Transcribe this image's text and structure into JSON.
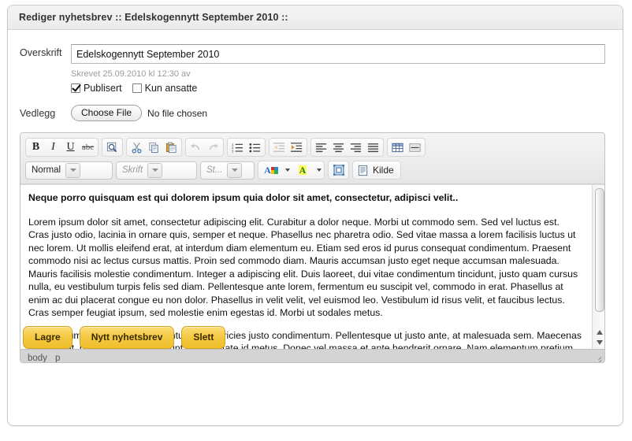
{
  "panel": {
    "title": "Rediger nyhetsbrev :: Edelskogennytt September 2010 ::"
  },
  "form": {
    "title_label": "Overskrift",
    "title_value": "Edelskogennytt September 2010",
    "title_placeholder": "",
    "meta": "Skrevet 25.09.2010 kl 12:30 av",
    "published_label": "Publisert",
    "published_checked": true,
    "staff_only_label": "Kun ansatte",
    "staff_only_checked": false,
    "attachment_label": "Vedlegg",
    "choose_file_label": "Choose File",
    "no_file_label": "No file chosen"
  },
  "editor": {
    "toolbar": {
      "row1": [
        {
          "name": "bold-icon",
          "glyph": "B"
        },
        {
          "name": "italic-icon",
          "glyph": "I"
        },
        {
          "name": "underline-icon",
          "glyph": "U"
        },
        {
          "name": "strikethrough-icon",
          "glyph": "abc"
        },
        {
          "name": "preview-icon",
          "glyph": "⌕"
        },
        {
          "name": "cut-icon",
          "glyph": "✂"
        },
        {
          "name": "copy-icon",
          "glyph": "⧉"
        },
        {
          "name": "paste-icon",
          "glyph": "ὌB"
        },
        {
          "name": "undo-icon",
          "glyph": "↩"
        },
        {
          "name": "redo-icon",
          "glyph": "↪"
        },
        {
          "name": "numbered-list-icon",
          "glyph": "1."
        },
        {
          "name": "bulleted-list-icon",
          "glyph": "•"
        },
        {
          "name": "outdent-icon",
          "glyph": "⇤"
        },
        {
          "name": "indent-icon",
          "glyph": "⇥"
        },
        {
          "name": "align-left-icon",
          "glyph": "≡"
        },
        {
          "name": "align-center-icon",
          "glyph": "≡"
        },
        {
          "name": "align-right-icon",
          "glyph": "≡"
        },
        {
          "name": "justify-icon",
          "glyph": "≡"
        },
        {
          "name": "table-icon",
          "glyph": "▦"
        },
        {
          "name": "horizontal-rule-icon",
          "glyph": "▤"
        }
      ],
      "format_select": "Normal",
      "font_select": "Skrift",
      "size_select": "St...",
      "text_color_label": "A",
      "bg_color_label": "A",
      "maximize_icon": "maximize-icon",
      "source_label": "Kilde"
    },
    "content": {
      "lead": "Neque porro quisquam est qui dolorem ipsum quia dolor sit amet, consectetur, adipisci velit..",
      "paragraph1": "Lorem ipsum dolor sit amet, consectetur adipiscing elit. Curabitur a dolor neque. Morbi ut commodo sem. Sed vel luctus est. Cras justo odio, lacinia in ornare quis, semper et neque. Phasellus nec pharetra odio. Sed vitae massa a lorem facilisis luctus ut nec lorem. Ut mollis eleifend erat, at interdum diam elementum eu. Etiam sed eros id purus consequat condimentum. Praesent commodo nisi ac lectus cursus mattis. Proin sed commodo diam. Mauris accumsan justo eget neque accumsan malesuada. Mauris facilisis molestie condimentum. Integer a adipiscing elit. Duis laoreet, dui vitae condimentum tincidunt, justo quam cursus nulla, eu vestibulum turpis felis sed diam. Pellentesque ante lorem, fermentum eu suscipit vel, commodo in erat. Phasellus at enim ac dui placerat congue eu non dolor. Phasellus in velit velit, vel euismod leo. Vestibulum id risus velit, et faucibus lectus. Cras semper feugiat ipsum, sed molestie enim egestas id. Morbi ut sodales metus.",
      "paragraph2": "Nunc rutrum urna eget dui elementum non ultricies justo condimentum. Pellentesque ut justo ante, at malesuada sem. Maecenas metus erat, rutrum sit amet tincidunt ut, vulputate id metus. Donec vel massa et ante hendrerit ornare. Nam elementum pretium"
    },
    "statusbar": {
      "path1": "body",
      "path2": "p"
    }
  },
  "buttons": {
    "save": "Lagre",
    "new": "Nytt nyhetsbrev",
    "delete": "Slett"
  },
  "colors": {
    "accent": "#f3c73f",
    "panel_header": "#eeeeee",
    "statusbar": "#d4d4d4"
  }
}
